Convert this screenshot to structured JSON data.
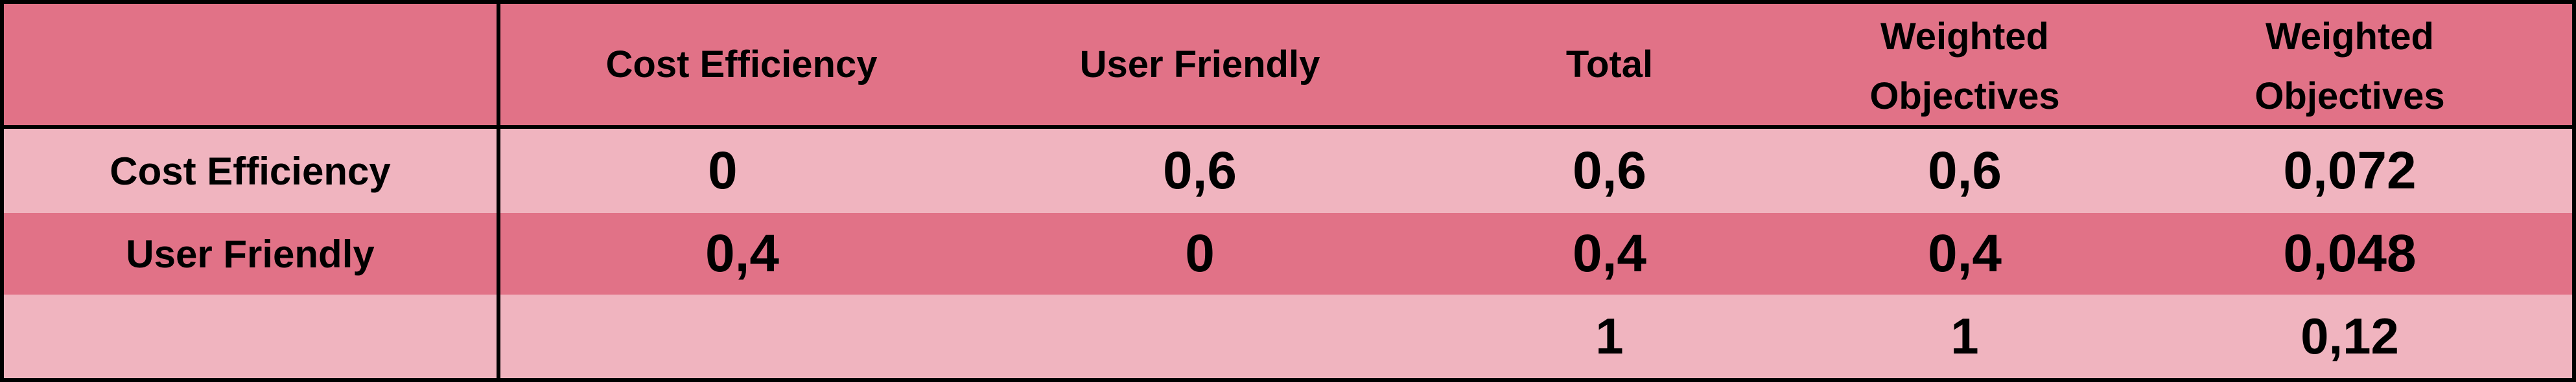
{
  "header": {
    "corner": "",
    "col_cost_efficiency": "Cost Efficiency",
    "col_user_friendly": "User Friendly",
    "col_total": "Total",
    "col_weighted_objectives_1": "Weighted\nObjectives",
    "col_weighted_objectives_2": "Weighted\nObjectives"
  },
  "rows": [
    {
      "label": "Cost Efficiency",
      "cost_efficiency": "0",
      "user_friendly": "0,6",
      "total": "0,6",
      "weighted_1": "0,6",
      "weighted_2": "0,072"
    },
    {
      "label": "User Friendly",
      "cost_efficiency": "0,4",
      "user_friendly": "0",
      "total": "0,4",
      "weighted_1": "0,4",
      "weighted_2": "0,048"
    },
    {
      "label": "",
      "cost_efficiency": "",
      "user_friendly": "",
      "total": "1",
      "weighted_1": "1",
      "weighted_2": "0,12"
    }
  ],
  "colors": {
    "header_bg": "#e17287",
    "row_light": "#f0b4bf",
    "row_dark": "#e17287",
    "border": "#000000"
  }
}
